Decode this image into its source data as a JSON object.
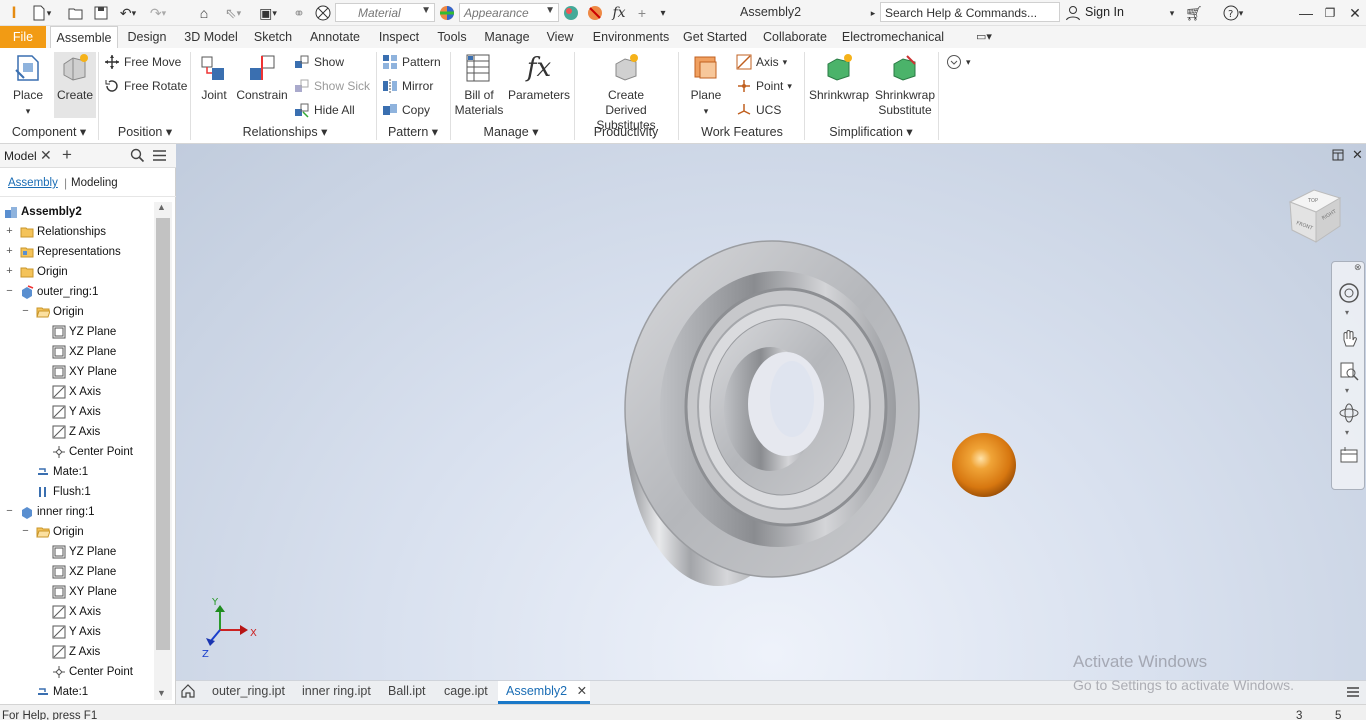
{
  "qat": {
    "material_placeholder": "Material",
    "appearance_placeholder": "Appearance",
    "title": "Assembly2",
    "search_placeholder": "Search Help & Commands...",
    "sign_in": "Sign In"
  },
  "tabs": [
    "File",
    "Assemble",
    "Design",
    "3D Model",
    "Sketch",
    "Annotate",
    "Inspect",
    "Tools",
    "Manage",
    "View",
    "Environments",
    "Get Started",
    "Collaborate",
    "Electromechanical"
  ],
  "active_tab": "Assemble",
  "ribbon": {
    "component": {
      "place": "Place",
      "create": "Create",
      "label": "Component"
    },
    "position": {
      "free_move": "Free Move",
      "free_rotate": "Free Rotate",
      "label": "Position"
    },
    "relationships": {
      "joint": "Joint",
      "constrain": "Constrain",
      "show": "Show",
      "show_sick": "Show Sick",
      "hide_all": "Hide All",
      "label": "Relationships"
    },
    "pattern": {
      "pattern": "Pattern",
      "mirror": "Mirror",
      "copy": "Copy",
      "label": "Pattern"
    },
    "manage": {
      "bom": "Bill of Materials",
      "parameters": "Parameters",
      "label": "Manage"
    },
    "productivity": {
      "create_derived": "Create Derived Substitutes",
      "label": "Productivity"
    },
    "work_features": {
      "plane": "Plane",
      "axis": "Axis",
      "point": "Point",
      "ucs": "UCS",
      "label": "Work Features"
    },
    "simplification": {
      "shrinkwrap": "Shrinkwrap",
      "shrinkwrap_sub": "Shrinkwrap Substitute",
      "label": "Simplification"
    }
  },
  "browser": {
    "tab_model": "Model",
    "sub_assembly": "Assembly",
    "sub_modeling": "Modeling",
    "items": [
      {
        "label": "Assembly2",
        "indent": 0,
        "icon": "assembly",
        "exp": ""
      },
      {
        "label": "Relationships",
        "indent": 1,
        "icon": "folder",
        "exp": "+"
      },
      {
        "label": "Representations",
        "indent": 1,
        "icon": "folder-rep",
        "exp": "+"
      },
      {
        "label": "Origin",
        "indent": 1,
        "icon": "folder",
        "exp": "+"
      },
      {
        "label": "outer_ring:1",
        "indent": 1,
        "icon": "part-link",
        "exp": "−"
      },
      {
        "label": "Origin",
        "indent": 2,
        "icon": "folder-open",
        "exp": "−"
      },
      {
        "label": "YZ Plane",
        "indent": 3,
        "icon": "plane",
        "exp": ""
      },
      {
        "label": "XZ Plane",
        "indent": 3,
        "icon": "plane",
        "exp": ""
      },
      {
        "label": "XY Plane",
        "indent": 3,
        "icon": "plane",
        "exp": ""
      },
      {
        "label": "X Axis",
        "indent": 3,
        "icon": "axis",
        "exp": ""
      },
      {
        "label": "Y Axis",
        "indent": 3,
        "icon": "axis",
        "exp": ""
      },
      {
        "label": "Z Axis",
        "indent": 3,
        "icon": "axis",
        "exp": ""
      },
      {
        "label": "Center Point",
        "indent": 3,
        "icon": "point",
        "exp": ""
      },
      {
        "label": "Mate:1",
        "indent": 2,
        "icon": "mate",
        "exp": ""
      },
      {
        "label": "Flush:1",
        "indent": 2,
        "icon": "flush",
        "exp": ""
      },
      {
        "label": "inner ring:1",
        "indent": 1,
        "icon": "part",
        "exp": "−"
      },
      {
        "label": "Origin",
        "indent": 2,
        "icon": "folder-open",
        "exp": "−"
      },
      {
        "label": "YZ Plane",
        "indent": 3,
        "icon": "plane",
        "exp": ""
      },
      {
        "label": "XZ Plane",
        "indent": 3,
        "icon": "plane",
        "exp": ""
      },
      {
        "label": "XY Plane",
        "indent": 3,
        "icon": "plane",
        "exp": ""
      },
      {
        "label": "X Axis",
        "indent": 3,
        "icon": "axis",
        "exp": ""
      },
      {
        "label": "Y Axis",
        "indent": 3,
        "icon": "axis",
        "exp": ""
      },
      {
        "label": "Z Axis",
        "indent": 3,
        "icon": "axis",
        "exp": ""
      },
      {
        "label": "Center Point",
        "indent": 3,
        "icon": "point",
        "exp": ""
      },
      {
        "label": "Mate:1",
        "indent": 2,
        "icon": "mate",
        "exp": ""
      }
    ]
  },
  "viewcube": {
    "top": "TOP",
    "front": "FRONT",
    "right": "RIGHT"
  },
  "triad": {
    "x": "X",
    "y": "Y",
    "z": "Z"
  },
  "doc_tabs": [
    "outer_ring.ipt",
    "inner ring.ipt",
    "Ball.ipt",
    "cage.ipt",
    "Assembly2"
  ],
  "active_doc": "Assembly2",
  "status": {
    "help": "For Help, press F1",
    "count1": "3",
    "count2": "5"
  },
  "watermark": {
    "line1": "Activate Windows",
    "line2": "Go to Settings to activate Windows."
  },
  "colors": {
    "file_tab": "#f29b14",
    "accent": "#1a78c8",
    "ball": "#e8861a",
    "metal": "#b7b9bd"
  }
}
